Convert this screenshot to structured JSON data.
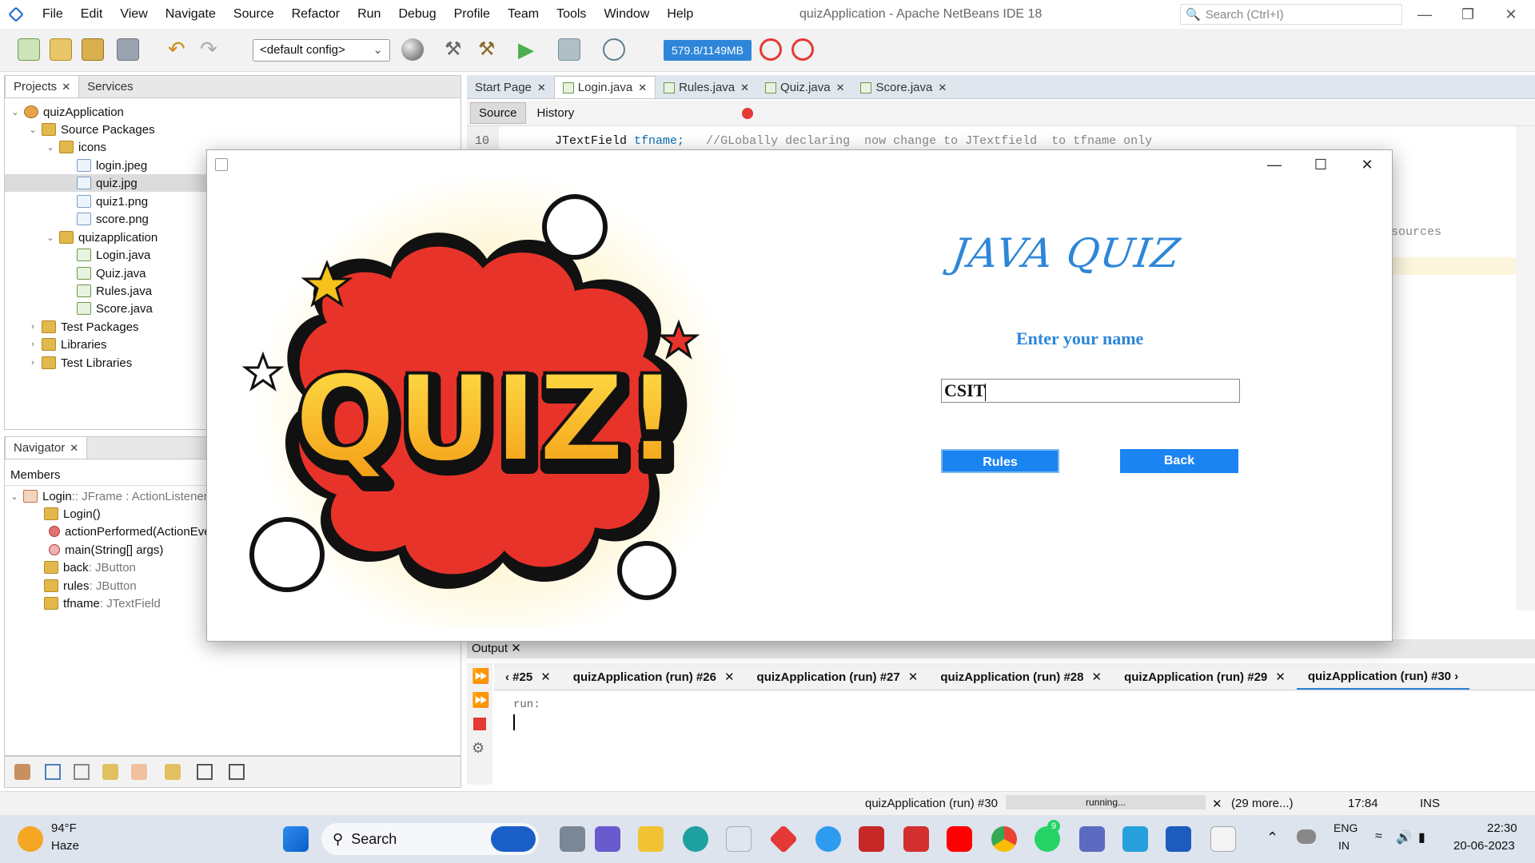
{
  "menubar": {
    "items": [
      "File",
      "Edit",
      "View",
      "Navigate",
      "Source",
      "Refactor",
      "Run",
      "Debug",
      "Profile",
      "Team",
      "Tools",
      "Window",
      "Help"
    ],
    "title": "quizApplication - Apache NetBeans IDE 18",
    "search_placeholder": "Search (Ctrl+I)"
  },
  "toolbar": {
    "config": "<default config>",
    "memory": "579.8/1149MB"
  },
  "projects_pane": {
    "tabs": [
      "Projects",
      "Services"
    ],
    "tree": [
      {
        "label": "quizApplication"
      },
      {
        "label": "Source Packages"
      },
      {
        "label": "icons"
      },
      {
        "label": "login.jpeg"
      },
      {
        "label": "quiz.jpg"
      },
      {
        "label": "quiz1.png"
      },
      {
        "label": "score.png"
      },
      {
        "label": "quizapplication"
      },
      {
        "label": "Login.java"
      },
      {
        "label": "Quiz.java"
      },
      {
        "label": "Rules.java"
      },
      {
        "label": "Score.java"
      },
      {
        "label": "Test Packages"
      },
      {
        "label": "Libraries"
      },
      {
        "label": "Test Libraries"
      }
    ]
  },
  "navigator_pane": {
    "tab": "Navigator",
    "members_label": "Members",
    "items": [
      {
        "name": "Login",
        "type": " :: JFrame : ActionListener"
      },
      {
        "name": "Login()",
        "type": ""
      },
      {
        "name": "actionPerformed(ActionEve",
        "type": ""
      },
      {
        "name": "main(String[] args)",
        "type": ""
      },
      {
        "name": "back",
        "type": " : JButton"
      },
      {
        "name": "rules",
        "type": " : JButton"
      },
      {
        "name": "tfname",
        "type": " : JTextField"
      }
    ]
  },
  "editor": {
    "tabs": [
      "Start Page",
      "Login.java",
      "Rules.java",
      "Quiz.java",
      "Score.java"
    ],
    "source_tab": "Source",
    "history_tab": "History",
    "line_number": "10",
    "code_type": "JTextField",
    "code_field": "tfname;",
    "code_comment": "//GLobally declaring  now change to JTextfield  to tfname only",
    "hidden_fragment": "sources"
  },
  "output": {
    "title": "Output",
    "tabs": [
      "#25",
      "quizApplication (run) #26",
      "quizApplication (run) #27",
      "quizApplication (run) #28",
      "quizApplication (run) #29",
      "quizApplication (run) #30"
    ],
    "text": "run:"
  },
  "statusbar": {
    "task": "quizApplication (run) #30",
    "progress": "running...",
    "more": "(29 more...)",
    "position": "17:84",
    "mode": "INS"
  },
  "taskbar": {
    "weather_temp": "94°F",
    "weather_desc": "Haze",
    "search": "Search",
    "lang1": "ENG",
    "lang2": "IN",
    "time": "22:30",
    "date": "20-06-2023",
    "whatsapp_badge": "9"
  },
  "app_window": {
    "art_text": "QUIZ!",
    "title": "JAVA QUIZ",
    "prompt": "Enter your name",
    "name_value": "CSIT",
    "rules_button": "Rules",
    "back_button": "Back"
  },
  "colors": {
    "accent": "#2d86d9",
    "button": "#1a84f0",
    "quiz_red": "#e8332a",
    "quiz_yellow": "#f7c21b"
  }
}
